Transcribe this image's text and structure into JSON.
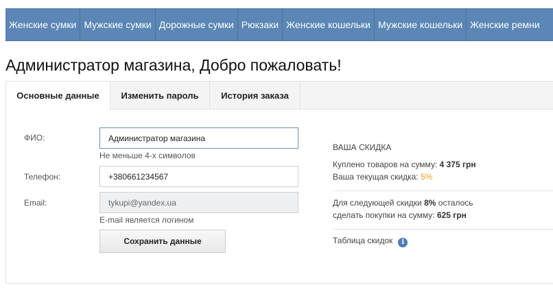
{
  "nav": {
    "items": [
      "Женские сумки",
      "Мужские сумки",
      "Дорожные сумки",
      "Рюкзаки",
      "Женские кошельки",
      "Мужские кошельки",
      "Женские ремни"
    ]
  },
  "page": {
    "title": "Администратор магазина, Добро пожаловать!"
  },
  "tabs": [
    "Основные данные",
    "Изменить пароль",
    "История заказа"
  ],
  "form": {
    "fio_label": "ФИО:",
    "fio_value": "Администратор магазина",
    "fio_hint": "Не меньше 4-х символов",
    "phone_label": "Телефон:",
    "phone_value": "+380661234567",
    "email_label": "Email:",
    "email_value": "tykupi@yandex.ua",
    "email_hint": "E-mail является логином",
    "save_label": "Сохранить данные"
  },
  "discount": {
    "title": "ВАША СКИДКА",
    "bought_prefix": "Куплено товаров на сумму:",
    "bought_value": "4 375 грн",
    "current_prefix": "Ваша текущая скидка:",
    "current_value": "5%",
    "next_prefix": "Для следующей скидки",
    "next_percent": "8%",
    "next_suffix": "осталось",
    "remaining_prefix": "сделать покупки на сумму:",
    "remaining_value": "625 грн",
    "table_link": "Таблица скидок",
    "info_glyph": "i"
  }
}
